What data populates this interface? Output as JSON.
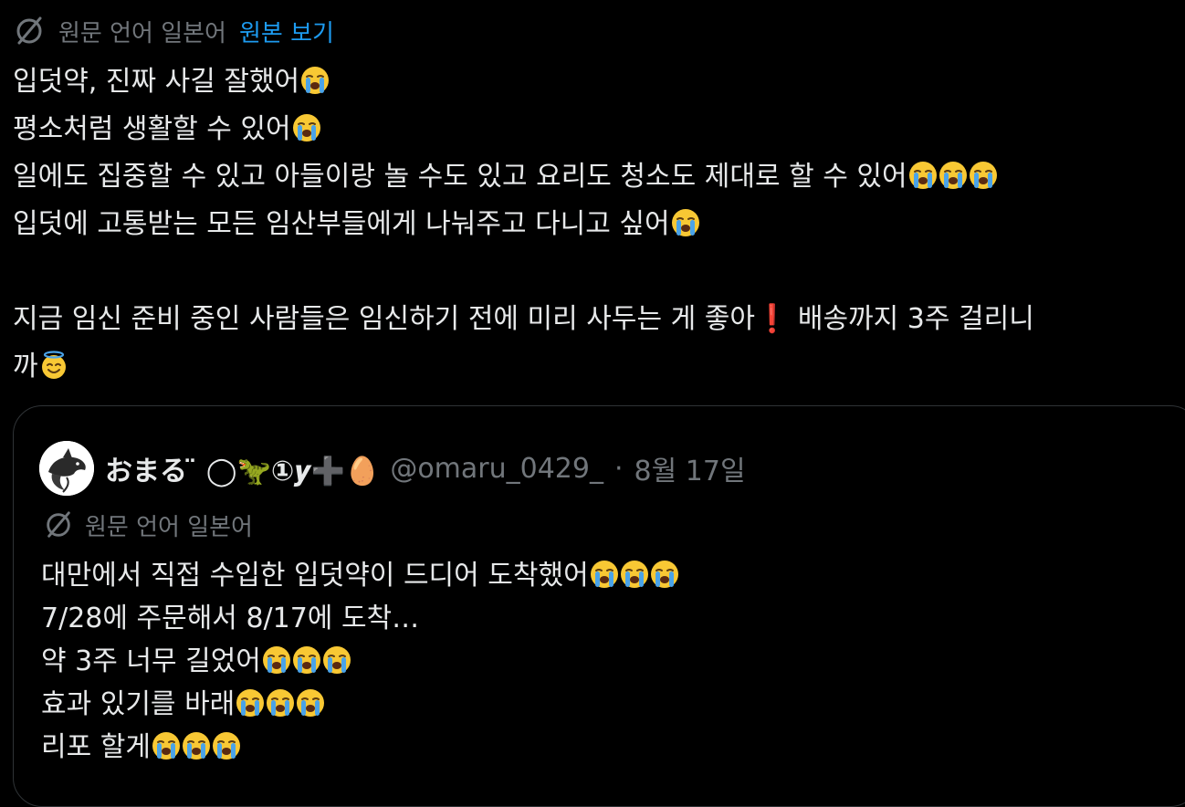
{
  "translation": {
    "label": "원문 언어 일본어",
    "show_original": "원본 보기"
  },
  "post": {
    "lines": [
      {
        "text": "입덧약, 진짜 사길 잘했어",
        "emoji": "loudly-crying-face",
        "count": 1
      },
      {
        "text": "평소처럼 생활할 수 있어",
        "emoji": "loudly-crying-face",
        "count": 1
      },
      {
        "text": "일에도 집중할 수 있고 아들이랑 놀 수도 있고 요리도 청소도 제대로 할 수 있어",
        "emoji": "loudly-crying-face",
        "count": 3
      },
      {
        "text": "입덧에 고통받는 모든 임산부들에게 나눠주고 다니고 싶어",
        "emoji": "loudly-crying-face",
        "count": 1
      },
      {
        "text": "",
        "emoji": "",
        "count": 0
      },
      {
        "text": "지금 임신 준비 중인 사람들은 임신하기 전에 미리 사두는 게 좋아❗️ 배송까지 3주 걸리니",
        "emoji": "",
        "count": 0
      },
      {
        "text": "까",
        "emoji": "smiling-face-with-halo",
        "count": 1
      }
    ]
  },
  "quote": {
    "avatar": "dolphin-sketch-avatar",
    "display_name": "おまる ̈ ◯🦖①𝒚➕🥚",
    "handle": "@omaru_0429_",
    "separator": "·",
    "date": "8월 17일",
    "translation_label": "원문 언어 일본어",
    "lines": [
      {
        "text": "대만에서 직접 수입한 입덧약이 드디어 도착했어",
        "emoji": "loudly-crying-face",
        "count": 3
      },
      {
        "text": "7/28에 주문해서 8/17에 도착…",
        "emoji": "",
        "count": 0
      },
      {
        "text": "약 3주 너무 길었어",
        "emoji": "loudly-crying-face",
        "count": 3
      },
      {
        "text": "효과 있기를 바래",
        "emoji": "loudly-crying-face",
        "count": 3
      },
      {
        "text": "리포 할게",
        "emoji": "loudly-crying-face",
        "count": 3
      }
    ]
  },
  "colors": {
    "background": "#000000",
    "text": "#e7e9ea",
    "muted": "#71767b",
    "link": "#1d9bf0",
    "border": "#2f3336",
    "emoji_yellow": "#f8c834",
    "tear_blue": "#4aa3e8"
  }
}
